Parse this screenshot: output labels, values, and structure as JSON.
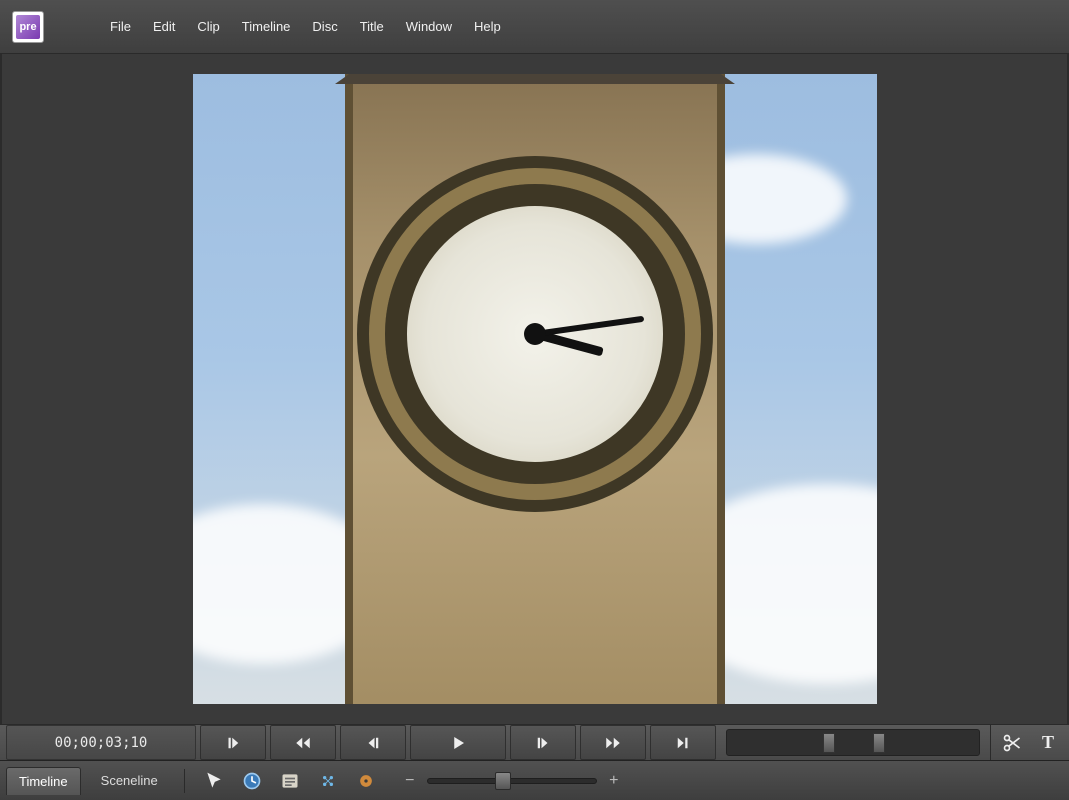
{
  "app": {
    "logo_text": "pre"
  },
  "menu": {
    "items": [
      "File",
      "Edit",
      "Clip",
      "Timeline",
      "Disc",
      "Title",
      "Window",
      "Help"
    ]
  },
  "transport": {
    "timecode": "00;00;03;10",
    "buttons": {
      "in_point": "Set In Point",
      "rewind": "Rewind",
      "step_back": "Step Back",
      "play": "Play",
      "step_fwd": "Step Forward",
      "fast_fwd": "Fast Forward",
      "out_point": "Set Out Point"
    },
    "split_tooltip": "Split Clip",
    "title_tool": "T"
  },
  "tabs": {
    "timeline": "Timeline",
    "sceneline": "Sceneline",
    "active": "timeline"
  },
  "tools": {
    "selection": "Selection Tool",
    "time_stretch": "Time Stretch Tool",
    "properties": "Properties",
    "marker": "Marker",
    "dvd_marker": "DVD Marker"
  },
  "zoom": {
    "minus": "−",
    "plus": "+"
  }
}
